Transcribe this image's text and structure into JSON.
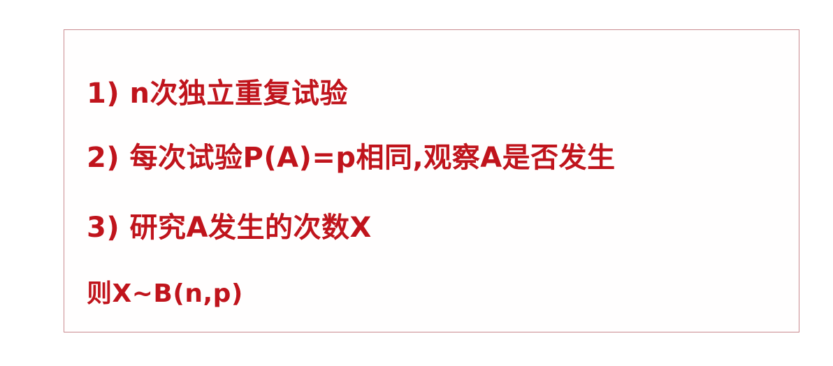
{
  "lines": [
    "1) n次独立重复试验",
    "2) 每次试验P(A)=p相同,观察A是否发生",
    "3) 研究A发生的次数X",
    "则X~B(n,p)"
  ],
  "colors": {
    "text": "#c0141c",
    "border": "#c98a8f",
    "background": "#ffffff"
  }
}
